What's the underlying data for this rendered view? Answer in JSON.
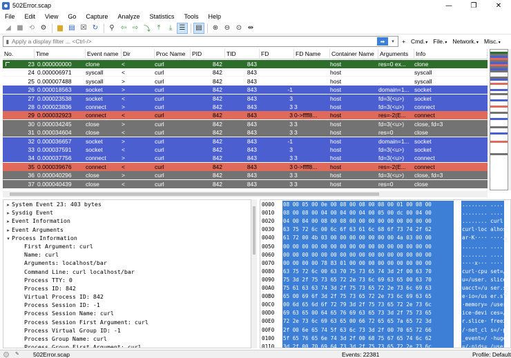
{
  "window": {
    "title": "502Error.scap",
    "minimize": "—",
    "restore": "❐",
    "close": "✕"
  },
  "menu": [
    "File",
    "Edit",
    "View",
    "Go",
    "Capture",
    "Analyze",
    "Statistics",
    "Tools",
    "Help"
  ],
  "toolbar": {
    "icons": [
      "start-capture-icon",
      "stop-capture-icon",
      "restart-capture-icon",
      "capture-options-icon",
      "open-file-icon",
      "save-file-icon",
      "close-file-icon",
      "reload-file-icon",
      "find-icon",
      "go-back-icon",
      "go-forward-icon",
      "go-to-packet-icon",
      "go-first-icon",
      "go-last-icon",
      "auto-scroll-icon",
      "colorize-icon",
      "zoom-in-icon",
      "zoom-out-icon",
      "normal-size-icon",
      "resize-columns-icon"
    ]
  },
  "filter": {
    "placeholder": "Apply a display filter ... <Ctrl-/>",
    "value": "",
    "apply_glyph": "➡",
    "buttons": [
      "+",
      "Cmd.",
      "File.",
      "Network.",
      "Misc."
    ]
  },
  "columns": [
    "No.",
    "Time",
    "Event name",
    "Dir",
    "Proc Name",
    "PID",
    "TID",
    "FD",
    "FD Name",
    "Container Name",
    "Arguments",
    "Info"
  ],
  "colors": {
    "selected": "#2d6e2d",
    "socket": "#4b5fd0",
    "error": "#df6a5a",
    "close": "#737373",
    "default": "#ffffff"
  },
  "packets": [
    {
      "no": "23",
      "time": "0.000000000",
      "event": "clone",
      "dir": "<",
      "proc": "curl",
      "pid": "842",
      "tid": "843",
      "fd": "",
      "fdname": "",
      "container": "host",
      "args": "res=0 ex...",
      "info": "clone",
      "style": "selected"
    },
    {
      "no": "24",
      "time": "0.000006971",
      "event": "syscall",
      "dir": "<",
      "proc": "curl",
      "pid": "842",
      "tid": "843",
      "fd": "",
      "fdname": "",
      "container": "host",
      "args": "",
      "info": "syscall",
      "style": "default"
    },
    {
      "no": "25",
      "time": "0.000007488",
      "event": "syscall",
      "dir": ">",
      "proc": "curl",
      "pid": "842",
      "tid": "843",
      "fd": "",
      "fdname": "",
      "container": "host",
      "args": "",
      "info": "syscall",
      "style": "default"
    },
    {
      "no": "26",
      "time": "0.000018563",
      "event": "socket",
      "dir": ">",
      "proc": "curl",
      "pid": "842",
      "tid": "843",
      "fd": "-1",
      "fdname": "",
      "container": "host",
      "args": "domain=1...",
      "info": "socket",
      "style": "socket"
    },
    {
      "no": "27",
      "time": "0.000023538",
      "event": "socket",
      "dir": "<",
      "proc": "curl",
      "pid": "842",
      "tid": "843",
      "fd": "3",
      "fdname": "",
      "container": "host",
      "args": "fd=3(<u>)",
      "info": "socket",
      "style": "socket"
    },
    {
      "no": "28",
      "time": "0.000023836",
      "event": "connect",
      "dir": ">",
      "proc": "curl",
      "pid": "842",
      "tid": "843",
      "fd": "3",
      "fdname": "3",
      "container": "host",
      "args": "fd=3(<u>)",
      "info": "connect",
      "style": "socket"
    },
    {
      "no": "29",
      "time": "0.000032923",
      "event": "connect",
      "dir": "<",
      "proc": "curl",
      "pid": "842",
      "tid": "843",
      "fd": "3",
      "fdname": "0->ffff8...",
      "container": "host",
      "args": "res=-2(E...",
      "info": "connect",
      "style": "error"
    },
    {
      "no": "30",
      "time": "0.000034245",
      "event": "close",
      "dir": ">",
      "proc": "curl",
      "pid": "842",
      "tid": "843",
      "fd": "3",
      "fdname": "3",
      "container": "host",
      "args": "fd=3(<u>)",
      "info": "close, fd=3",
      "style": "close"
    },
    {
      "no": "31",
      "time": "0.000034604",
      "event": "close",
      "dir": "<",
      "proc": "curl",
      "pid": "842",
      "tid": "843",
      "fd": "3",
      "fdname": "3",
      "container": "host",
      "args": "res=0",
      "info": "close",
      "style": "close"
    },
    {
      "no": "32",
      "time": "0.000036657",
      "event": "socket",
      "dir": ">",
      "proc": "curl",
      "pid": "842",
      "tid": "843",
      "fd": "-1",
      "fdname": "",
      "container": "host",
      "args": "domain=1...",
      "info": "socket",
      "style": "socket"
    },
    {
      "no": "33",
      "time": "0.000037591",
      "event": "socket",
      "dir": "<",
      "proc": "curl",
      "pid": "842",
      "tid": "843",
      "fd": "3",
      "fdname": "",
      "container": "host",
      "args": "fd=3(<u>)",
      "info": "socket",
      "style": "socket"
    },
    {
      "no": "34",
      "time": "0.000037756",
      "event": "connect",
      "dir": ">",
      "proc": "curl",
      "pid": "842",
      "tid": "843",
      "fd": "3",
      "fdname": "3",
      "container": "host",
      "args": "fd=3(<u>)",
      "info": "connect",
      "style": "socket"
    },
    {
      "no": "35",
      "time": "0.000039676",
      "event": "connect",
      "dir": "<",
      "proc": "curl",
      "pid": "842",
      "tid": "843",
      "fd": "3",
      "fdname": "0->ffff8...",
      "container": "host",
      "args": "res=-2(E...",
      "info": "connect",
      "style": "error"
    },
    {
      "no": "36",
      "time": "0.000040296",
      "event": "close",
      "dir": ">",
      "proc": "curl",
      "pid": "842",
      "tid": "843",
      "fd": "3",
      "fdname": "3",
      "container": "host",
      "args": "fd=3(<u>)",
      "info": "close, fd=3",
      "style": "close"
    },
    {
      "no": "37",
      "time": "0.000040439",
      "event": "close",
      "dir": "<",
      "proc": "curl",
      "pid": "842",
      "tid": "843",
      "fd": "3",
      "fdname": "3",
      "container": "host",
      "args": "res=0",
      "info": "close",
      "style": "close"
    }
  ],
  "minimap_colors": [
    "#ffffff",
    "#2d6e2d",
    "#737373",
    "#4b5fd0",
    "#df6a5a",
    "#737373",
    "#4b5fd0",
    "#df6a5a",
    "#737373",
    "#4b5fd0",
    "#737373",
    "#ffffff",
    "#ffffff",
    "#737373",
    "#4b5fd0",
    "#ffffff",
    "#df6a5a",
    "#ffffff",
    "#ffffff",
    "#4b5fd0",
    "#ffffff",
    "#737373",
    "#ffffff",
    "#ffffff",
    "#4b5fd0",
    "#ffffff",
    "#ffffff",
    "#df6a5a",
    "#ffffff",
    "#ffffff",
    "#737373",
    "#ffffff",
    "#ffffff",
    "#4b5fd0",
    "#ffffff",
    "#ffffff",
    "#ffffff",
    "#737373",
    "#ffffff",
    "#ffffff",
    "#4b5fd0",
    "#ffffff",
    "#ffffff",
    "#ffffff",
    "#df6a5a",
    "#ffffff",
    "#ffffff",
    "#ffffff",
    "#ffffff",
    "#ffffff",
    "#737373",
    "#ffffff",
    "#ffffff",
    "#ffffff",
    "#ffffff",
    "#ffffff",
    "#ffffff",
    "#ffffff",
    "#ffffff",
    "#ffffff",
    "#ffffff",
    "#ffffff",
    "#ffffff",
    "#ffffff",
    "#ffffff",
    "#ffffff",
    "#ffffff",
    "#ffffff"
  ],
  "tree": [
    {
      "indent": 0,
      "arrow": "▸",
      "text": "System Event 23: 403 bytes"
    },
    {
      "indent": 0,
      "arrow": "▸",
      "text": "Sysdig Event"
    },
    {
      "indent": 0,
      "arrow": "▸",
      "text": "Event Information"
    },
    {
      "indent": 0,
      "arrow": "▸",
      "text": "Event Arguments"
    },
    {
      "indent": 0,
      "arrow": "▾",
      "text": "Process Information"
    },
    {
      "indent": 1,
      "arrow": "",
      "text": "First Argument: curl"
    },
    {
      "indent": 1,
      "arrow": "",
      "text": "Name: curl"
    },
    {
      "indent": 1,
      "arrow": "",
      "text": "Arguments: localhost/bar"
    },
    {
      "indent": 1,
      "arrow": "",
      "text": "Command Line: curl localhost/bar"
    },
    {
      "indent": 1,
      "arrow": "",
      "text": "Process TTY: 0"
    },
    {
      "indent": 1,
      "arrow": "",
      "text": "Process ID: 842"
    },
    {
      "indent": 1,
      "arrow": "",
      "text": "Virtual Process ID: 842"
    },
    {
      "indent": 1,
      "arrow": "",
      "text": "Process Session ID: -1"
    },
    {
      "indent": 1,
      "arrow": "",
      "text": "Process Session Name: curl"
    },
    {
      "indent": 1,
      "arrow": "",
      "text": "Process Session First Argument: curl"
    },
    {
      "indent": 1,
      "arrow": "",
      "text": "Process Virtual Group ID: -1"
    },
    {
      "indent": 1,
      "arrow": "",
      "text": "Process Group Name: curl"
    },
    {
      "indent": 1,
      "arrow": "",
      "text": "Process Group First Argument: curl"
    }
  ],
  "hex": [
    {
      "off": "0000",
      "bytes": "08 00 05 00 0e 00 08 00  08 00 08 00 01 00 08 00",
      "ascii": "........ ......."
    },
    {
      "off": "0010",
      "bytes": "08 00 08 00 04 00 04 00  04 00 05 00 dc 00 04 00",
      "ascii": "........ ......."
    },
    {
      "off": "0020",
      "bytes": "04 00 04 00 08 00 08 00  00 00 00 00 00 00 00 00",
      "ascii": "........ curl·loc alho"
    },
    {
      "off": "0030",
      "bytes": "63 75 72 6c 00 6c 6f 63  61 6c 68 6f 73 74 2f 62",
      "ascii": "curl·loc alhost/b"
    },
    {
      "off": "0040",
      "bytes": "61 72 00 4b 03 00 00 00  00 00 00 00 4a 03 00 00",
      "ascii": "ar·K····  ····J···"
    },
    {
      "off": "0050",
      "bytes": "00 00 00 00 00 00 00 00  00 00 00 00 00 00 00 00",
      "ascii": "........ ......."
    },
    {
      "off": "0060",
      "bytes": "00 00 00 00 00 00 00 00  00 00 00 00 00 00 00 00",
      "ascii": "........ ......."
    },
    {
      "off": "0070",
      "bytes": "00 00 00 00 78 83 01 00  00 00 00 00 00 00 00 00",
      "ascii": "····x··· ·······"
    },
    {
      "off": "0080",
      "bytes": "63 75 72 6c 00 63 70 75  73 65 74 3d 2f 00 63 70",
      "ascii": "curl·cpu set=/·cp"
    },
    {
      "off": "0090",
      "bytes": "75 3d 2f 75 73 65 72 2e  73 6c 69 63 65 00 63 70",
      "ascii": "u=/user. slice·cp"
    },
    {
      "off": "00A0",
      "bytes": "75 61 63 63 74 3d 2f 75  73 65 72 2e 73 6c 69 63",
      "ascii": "uacct=/u ser.slic"
    },
    {
      "off": "00B0",
      "bytes": "65 00 69 6f 3d 2f 75 73  65 72 2e 73 6c 69 63 65",
      "ascii": "e·io=/us er.slice"
    },
    {
      "off": "00C0",
      "bytes": "00 6d 65 6d 6f 72 79 3d  2f 75 73 65 72 2e 73 6c",
      "ascii": "·memory= /user.sl"
    },
    {
      "off": "00D0",
      "bytes": "69 63 65 00 64 65 76 69  63 65 73 3d 2f 75 73 65",
      "ascii": "ice·devi ces=/use"
    },
    {
      "off": "00E0",
      "bytes": "72 2e 73 6c 69 63 65 00  66 72 65 65 7a 65 72 3d",
      "ascii": "r.slice· freezer="
    },
    {
      "off": "00F0",
      "bytes": "2f 00 6e 65 74 5f 63 6c  73 3d 2f 00 70 65 72 66",
      "ascii": "/·net_cl s=/·perf"
    },
    {
      "off": "0100",
      "bytes": "5f 65 76 65 6e 74 3d 2f  00 68 75 67 65 74 6c 62",
      "ascii": "_event=/ ·hugetlb"
    },
    {
      "off": "0110",
      "bytes": "3d 2f 00 70 69 64 73 3d  2f 75 73 65 72 2e 73 6c",
      "ascii": "=/·pids= /user.sl"
    }
  ],
  "status": {
    "file": "502Error.scap",
    "events": "Events: 22381",
    "profile": "Profile: Default"
  }
}
